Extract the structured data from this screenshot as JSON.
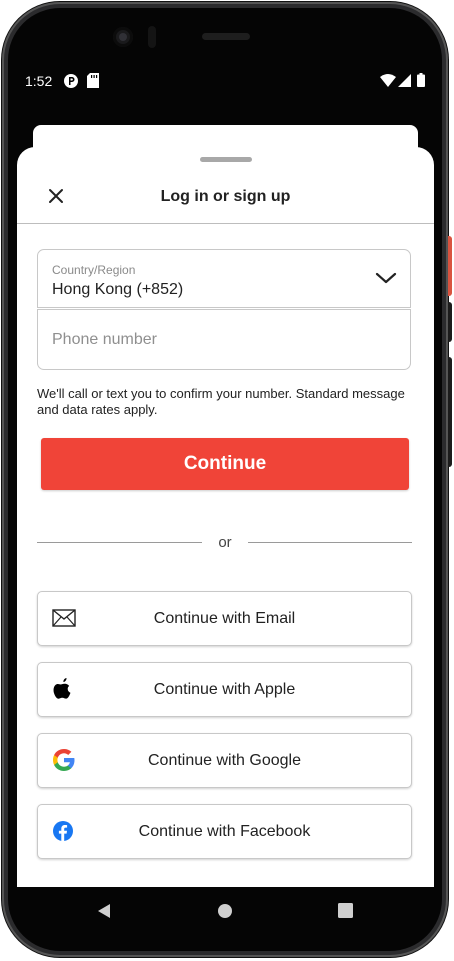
{
  "status_bar": {
    "time": "1:52"
  },
  "header": {
    "title": "Log in or sign up"
  },
  "country": {
    "label": "Country/Region",
    "value": "Hong Kong (+852)"
  },
  "phone": {
    "placeholder": "Phone number",
    "value": ""
  },
  "disclaimer": "We'll call or text you to confirm your number. Standard message and data rates apply.",
  "continue_label": "Continue",
  "divider_text": "or",
  "social_buttons": [
    {
      "label": "Continue with Email",
      "icon": "envelope-icon"
    },
    {
      "label": "Continue with Apple",
      "icon": "apple-icon"
    },
    {
      "label": "Continue with Google",
      "icon": "google-icon"
    },
    {
      "label": "Continue with Facebook",
      "icon": "facebook-icon"
    }
  ],
  "colors": {
    "primary": "#F04438",
    "border": "#C8C8C8",
    "google_blue": "#4285F4",
    "google_red": "#EA4335",
    "google_yellow": "#FBBC05",
    "google_green": "#34A853",
    "facebook_blue": "#1877F2"
  }
}
